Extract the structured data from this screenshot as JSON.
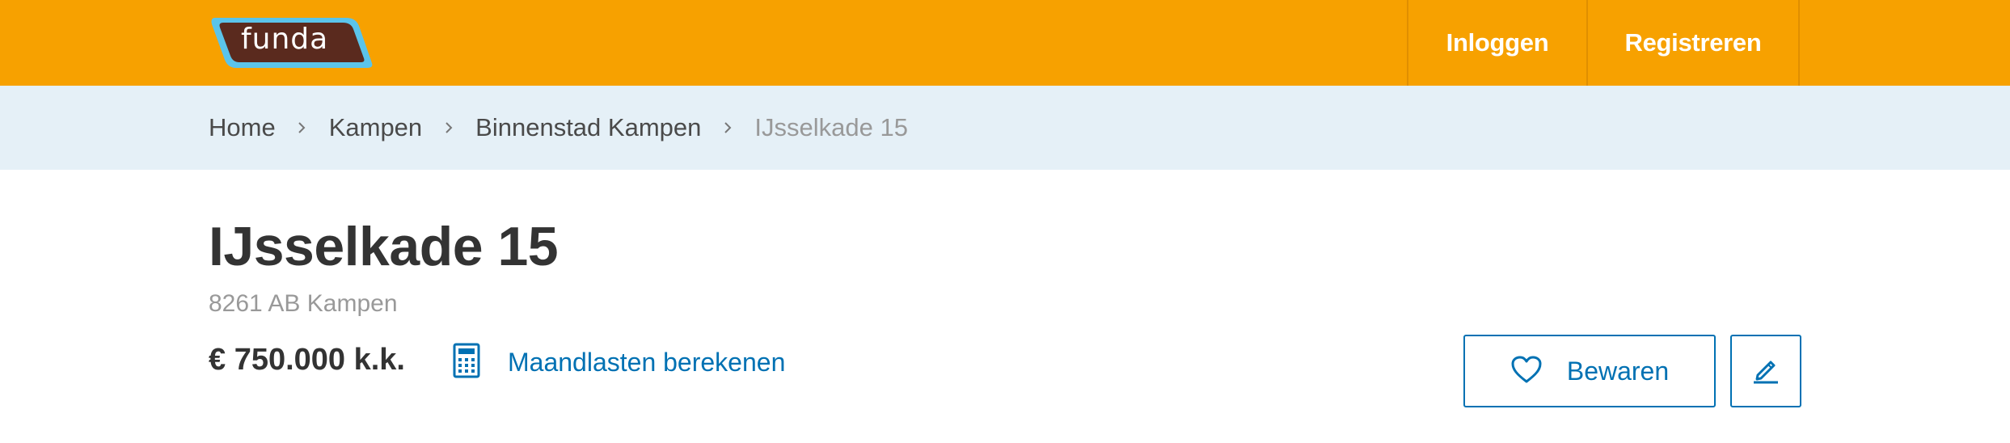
{
  "header": {
    "logo_text": "funda",
    "nav": [
      {
        "label": "Inloggen"
      },
      {
        "label": "Registreren"
      }
    ],
    "brand_color": "#f7a100"
  },
  "breadcrumb": {
    "items": [
      {
        "label": "Home"
      },
      {
        "label": "Kampen"
      },
      {
        "label": "Binnenstad Kampen"
      },
      {
        "label": "IJsselkade 15"
      }
    ],
    "separator_icon": "chevron-right-icon"
  },
  "listing": {
    "title": "IJsselkade 15",
    "postcode_city": "8261 AB Kampen",
    "price": "€ 750.000 k.k.",
    "calculator_label": "Maandlasten berekenen",
    "calculator_icon": "calculator-icon"
  },
  "actions": {
    "save_label": "Bewaren",
    "save_icon": "heart-icon",
    "edit_icon": "pencil-icon",
    "accent_color": "#0071b3"
  }
}
